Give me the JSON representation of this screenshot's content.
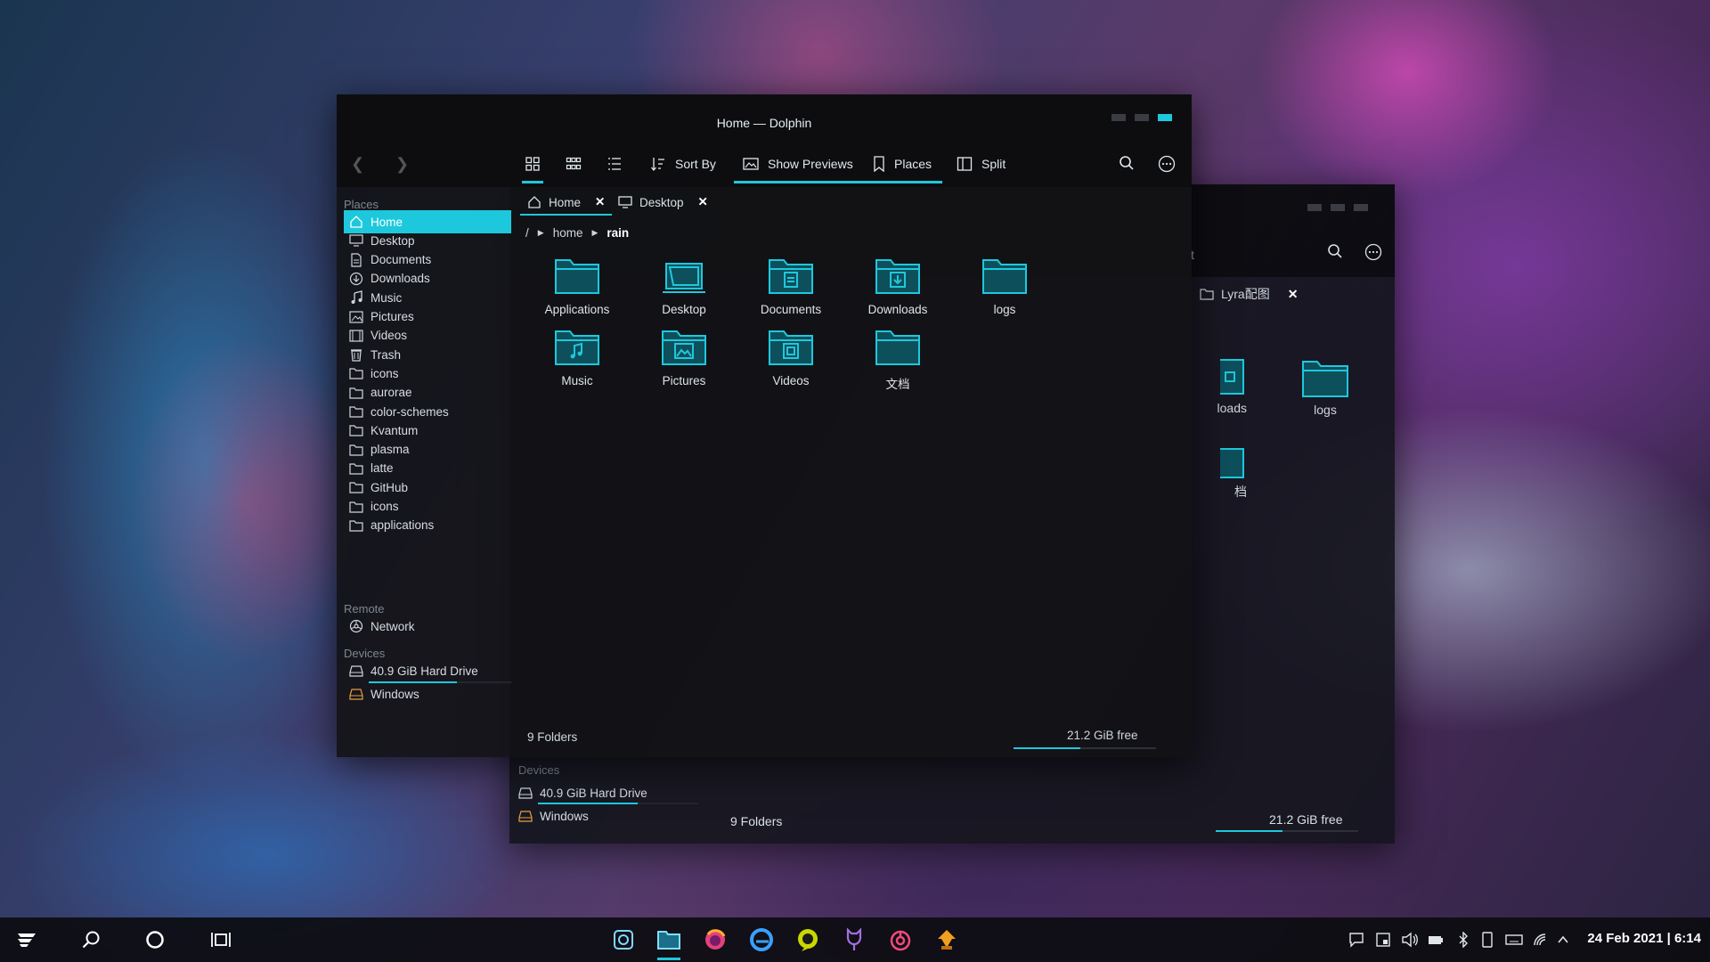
{
  "main_window": {
    "title": "Home — Dolphin",
    "toolbar": {
      "sort_label": "Sort By",
      "previews_label": "Show Previews",
      "places_label": "Places",
      "split_label": "Split"
    },
    "tabs": [
      {
        "label": "Home",
        "close": "✕"
      },
      {
        "label": "Desktop",
        "close": "✕"
      }
    ],
    "breadcrumb": {
      "root": "/",
      "part1": "home",
      "part2": "rain"
    },
    "sidebar": {
      "places_title": "Places",
      "places": [
        "Home",
        "Desktop",
        "Documents",
        "Downloads",
        "Music",
        "Pictures",
        "Videos",
        "Trash",
        "icons",
        "aurorae",
        "color-schemes",
        "Kvantum",
        "plasma",
        "latte",
        "GitHub",
        "icons",
        "applications"
      ],
      "remote_title": "Remote",
      "remote": [
        "Network"
      ],
      "devices_title": "Devices",
      "devices": [
        "40.9 GiB Hard Drive",
        "Windows"
      ]
    },
    "folders": [
      "Applications",
      "Desktop",
      "Documents",
      "Downloads",
      "logs",
      "Music",
      "Pictures",
      "Videos",
      "文档"
    ],
    "status": {
      "count": "9 Folders",
      "free": "21.2 GiB free",
      "free_fraction": 0.47
    }
  },
  "back_window": {
    "title_fragment": "t",
    "tab": {
      "label": "Lyra配图",
      "close": "✕"
    },
    "items": [
      "loads",
      "logs",
      "档"
    ],
    "devices_title": "Devices",
    "devices": [
      "40.9 GiB Hard Drive",
      "Windows"
    ],
    "status": {
      "count": "9 Folders",
      "free": "21.2 GiB free",
      "free_fraction": 0.47
    }
  },
  "taskbar": {
    "clock": "24 Feb 2021 | 6:14",
    "accent": "#1ec8dc"
  }
}
